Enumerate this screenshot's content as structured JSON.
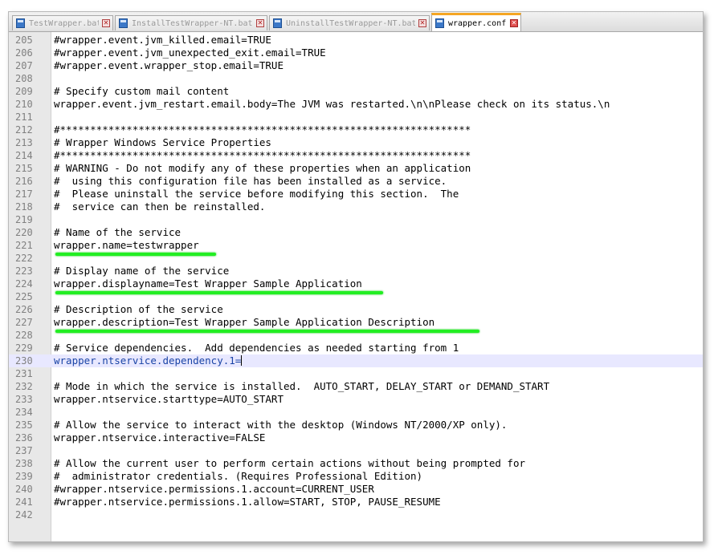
{
  "tabs": [
    {
      "label": "TestWrapper.bat",
      "active": false
    },
    {
      "label": "InstallTestWrapper-NT.bat",
      "active": false
    },
    {
      "label": "UninstallTestWrapper-NT.bat",
      "active": false
    },
    {
      "label": "wrapper.conf",
      "active": true
    }
  ],
  "editor": {
    "current_line": 230,
    "lines": [
      {
        "num": "205",
        "text": "#wrapper.event.jvm_killed.email=TRUE"
      },
      {
        "num": "206",
        "text": "#wrapper.event.jvm_unexpected_exit.email=TRUE"
      },
      {
        "num": "207",
        "text": "#wrapper.event.wrapper_stop.email=TRUE"
      },
      {
        "num": "208",
        "text": ""
      },
      {
        "num": "209",
        "text": "# Specify custom mail content"
      },
      {
        "num": "210",
        "text": "wrapper.event.jvm_restart.email.body=The JVM was restarted.\\n\\nPlease check on its status.\\n"
      },
      {
        "num": "211",
        "text": ""
      },
      {
        "num": "212",
        "text": "#********************************************************************"
      },
      {
        "num": "213",
        "text": "# Wrapper Windows Service Properties"
      },
      {
        "num": "214",
        "text": "#********************************************************************"
      },
      {
        "num": "215",
        "text": "# WARNING - Do not modify any of these properties when an application"
      },
      {
        "num": "216",
        "text": "#  using this configuration file has been installed as a service."
      },
      {
        "num": "217",
        "text": "#  Please uninstall the service before modifying this section.  The"
      },
      {
        "num": "218",
        "text": "#  service can then be reinstalled."
      },
      {
        "num": "219",
        "text": ""
      },
      {
        "num": "220",
        "text": "# Name of the service"
      },
      {
        "num": "221",
        "text": "wrapper.name=testwrapper"
      },
      {
        "num": "222",
        "text": ""
      },
      {
        "num": "223",
        "text": "# Display name of the service"
      },
      {
        "num": "224",
        "text": "wrapper.displayname=Test Wrapper Sample Application"
      },
      {
        "num": "225",
        "text": ""
      },
      {
        "num": "226",
        "text": "# Description of the service"
      },
      {
        "num": "227",
        "text": "wrapper.description=Test Wrapper Sample Application Description"
      },
      {
        "num": "228",
        "text": ""
      },
      {
        "num": "229",
        "text": "# Service dependencies.  Add dependencies as needed starting from 1"
      },
      {
        "num": "230",
        "text": "wrapper.ntservice.dependency.1="
      },
      {
        "num": "231",
        "text": ""
      },
      {
        "num": "232",
        "text": "# Mode in which the service is installed.  AUTO_START, DELAY_START or DEMAND_START"
      },
      {
        "num": "233",
        "text": "wrapper.ntservice.starttype=AUTO_START"
      },
      {
        "num": "234",
        "text": ""
      },
      {
        "num": "235",
        "text": "# Allow the service to interact with the desktop (Windows NT/2000/XP only)."
      },
      {
        "num": "236",
        "text": "wrapper.ntservice.interactive=FALSE"
      },
      {
        "num": "237",
        "text": ""
      },
      {
        "num": "238",
        "text": "# Allow the current user to perform certain actions without being prompted for"
      },
      {
        "num": "239",
        "text": "#  administrator credentials. (Requires Professional Edition)"
      },
      {
        "num": "240",
        "text": "#wrapper.ntservice.permissions.1.account=CURRENT_USER"
      },
      {
        "num": "241",
        "text": "#wrapper.ntservice.permissions.1.allow=START, STOP, PAUSE_RESUME"
      },
      {
        "num": "242",
        "text": ""
      }
    ]
  },
  "colors": {
    "highlight_underline": "#22ee22",
    "active_tab_accent": "#f5a623",
    "current_line_bg": "#e8e8ff"
  }
}
